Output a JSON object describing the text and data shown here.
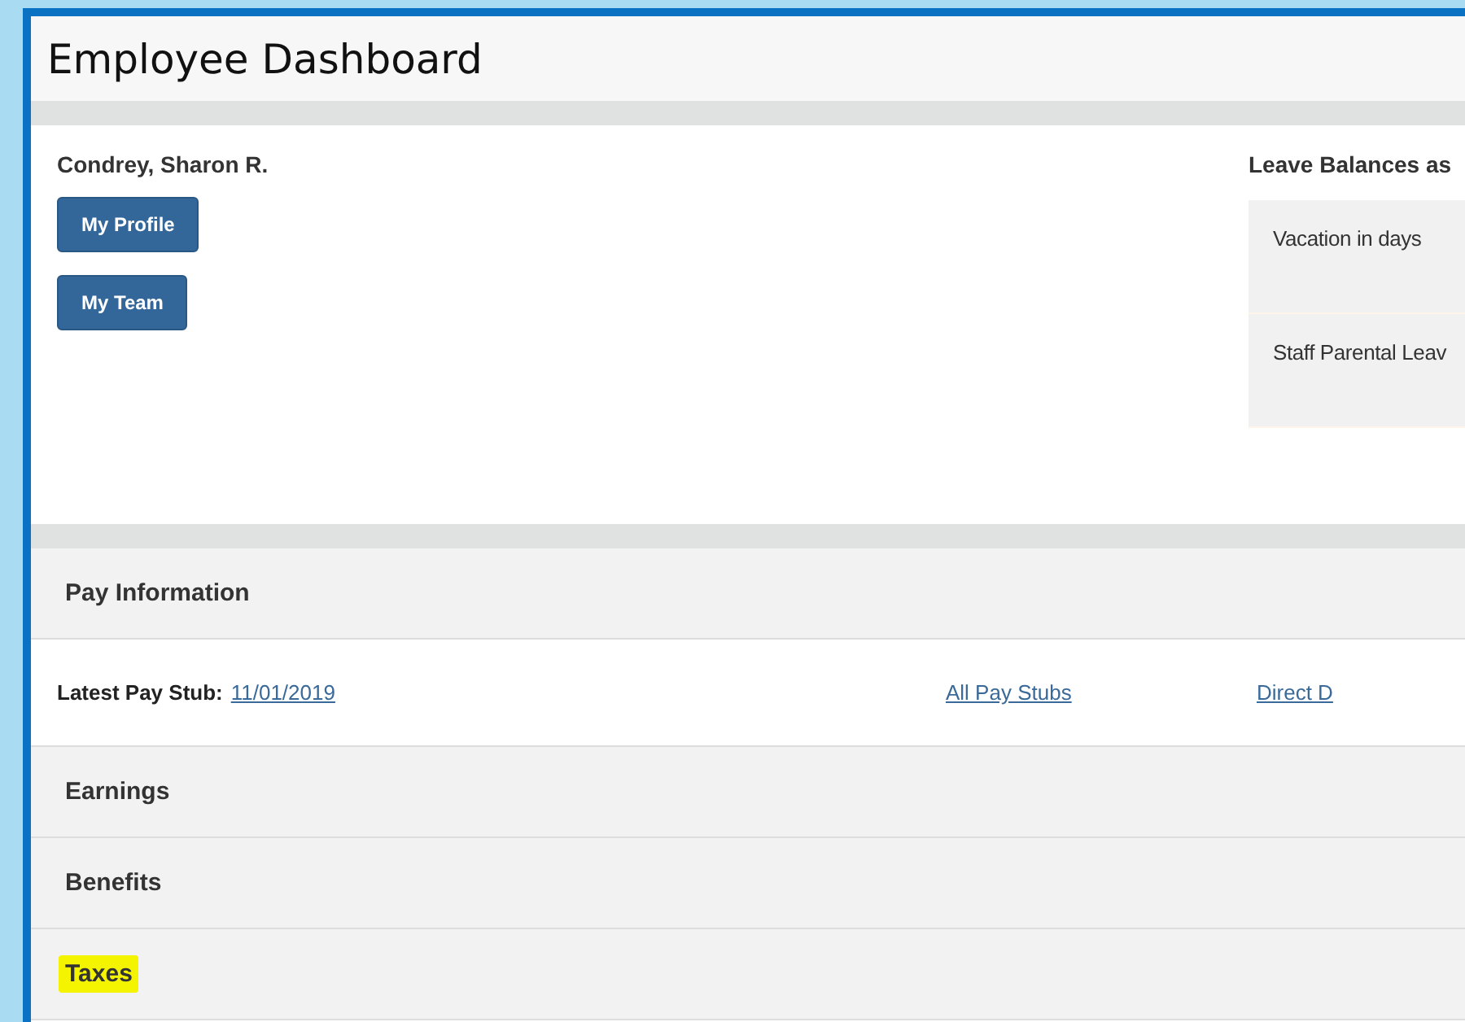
{
  "title": "Employee Dashboard",
  "employee": {
    "name": "Condrey, Sharon R.",
    "buttons": [
      "My Profile",
      "My Team"
    ]
  },
  "leave_balances": {
    "heading": "Leave Balances as",
    "rows": [
      "Vacation in days",
      "Staff Parental Leav"
    ]
  },
  "pay_information": {
    "heading": "Pay Information",
    "latest_label": "Latest Pay Stub:",
    "latest_date": "11/01/2019",
    "links": [
      "All Pay Stubs",
      "Direct D"
    ]
  },
  "sections": [
    {
      "label": "Earnings",
      "highlighted": false
    },
    {
      "label": "Benefits",
      "highlighted": false
    },
    {
      "label": "Taxes",
      "highlighted": true
    }
  ]
}
